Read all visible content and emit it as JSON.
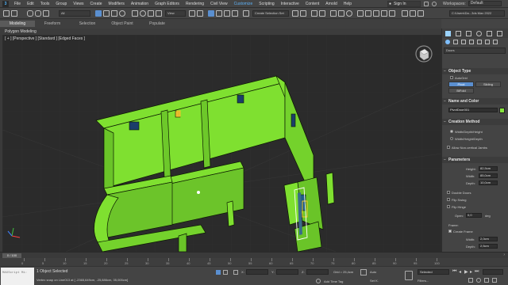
{
  "menu": {
    "items": [
      "File",
      "Edit",
      "Tools",
      "Group",
      "Views",
      "Create",
      "Modifiers",
      "Animation",
      "Graph Editors",
      "Rendering",
      "Civil View",
      "Customize",
      "Scripting",
      "Interactive",
      "Content",
      "Arnold",
      "Help"
    ],
    "active_index": 11,
    "sign_in": "Sign In",
    "workspaces_label": "Workspaces:",
    "workspaces_value": "Default"
  },
  "toolbar": {
    "filter_value": "All",
    "view_value": "View",
    "selection_set_value": "Create Selection Set",
    "path_value": "C:\\Users\\Da...3ds Max 2022"
  },
  "ribbon": {
    "tabs": [
      "Modeling",
      "Freeform",
      "Selection",
      "Object Paint",
      "Populate"
    ],
    "active_index": 0,
    "subtab": "Polygon Modeling"
  },
  "viewport": {
    "label": "[ + ] [Perspective ] [Standard ] [Edged Faces ]",
    "wireframe_color": "#7fe030"
  },
  "command_panel": {
    "category": "Doors",
    "object_type_title": "Object Type",
    "autogrid_label": "AutoGrid",
    "type_buttons": [
      "Pivot",
      "Sliding",
      "BiFold"
    ],
    "active_type": 0,
    "name_color_title": "Name and Color",
    "object_name": "PivotDoor001",
    "object_color": "#86e43c",
    "creation_method_title": "Creation Method",
    "creation_methods": [
      "Width/Depth/Height",
      "Width/Height/Depth"
    ],
    "selected_method": 0,
    "allow_nonvertical": "Allow Non-vertical Jambs",
    "parameters_title": "Parameters",
    "height_label": "Height:",
    "height_value": "82,9cm",
    "width_label": "Width:",
    "width_value": "85,0cm",
    "depth_label": "Depth:",
    "depth_value": "10,0cm",
    "double_doors": "Double Doors",
    "flip_swing": "Flip Swing",
    "flip_hinge": "Flip Hinge",
    "open_label": "Open:",
    "open_value": "0,0",
    "open_unit": "deg",
    "frame_label": "Frame:",
    "create_frame": "Create Frame",
    "frame_width_label": "Width:",
    "frame_width_value": "2,0cm",
    "frame_depth_label": "Depth:",
    "frame_depth_value": "2,5cm"
  },
  "timeline": {
    "slider_text": "0 / 100",
    "ticks": [
      "0",
      "5",
      "10",
      "15",
      "20",
      "25",
      "30",
      "35",
      "40",
      "45",
      "50",
      "55",
      "60",
      "65",
      "70",
      "75",
      "80",
      "85",
      "90",
      "95",
      "100"
    ]
  },
  "status": {
    "maxscript_text": "MAXScript Mi:",
    "selection_text": "1 Object Selected",
    "prompt_text": "Vertex snap on Line013 at [ -2365,649cm, -25,886cm, 35,005cm]",
    "x_label": "X:",
    "y_label": "Y:",
    "z_label": "Z:",
    "grid_text": "Grid = 25,4cm",
    "add_time_tag": "Add Time Tag",
    "auto_label": "Auto",
    "set_key_label": "Set K.",
    "selected_value": "Selected",
    "filters_label": "Filters..."
  }
}
